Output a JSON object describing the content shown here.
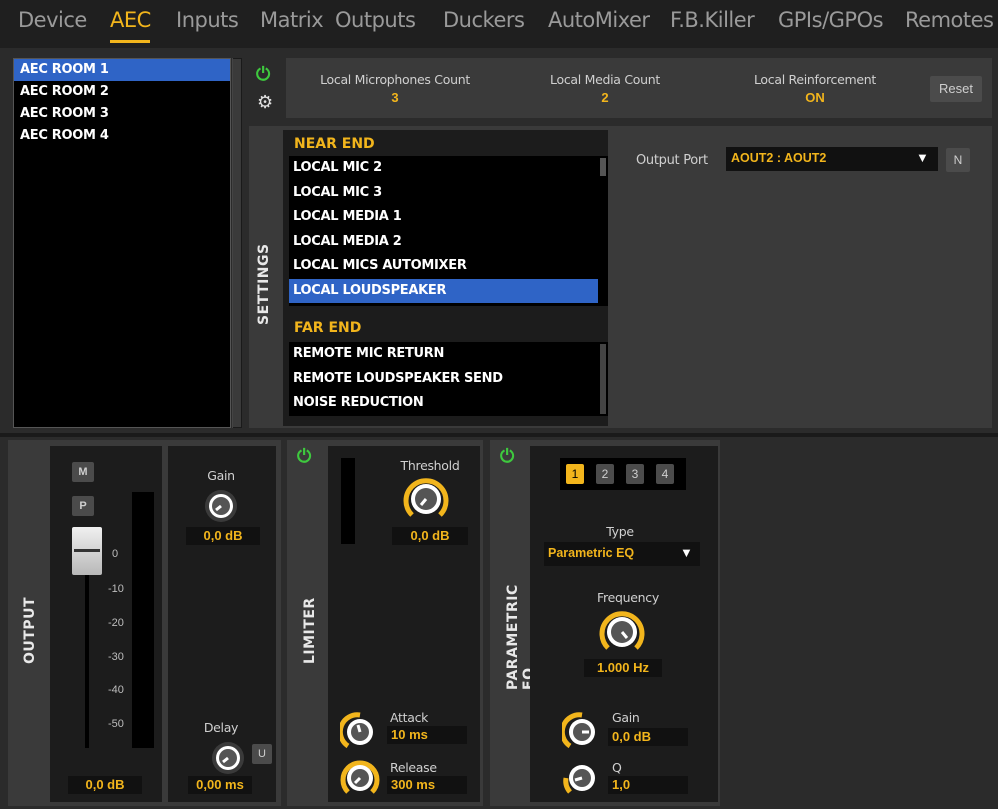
{
  "nav": {
    "tabs": [
      "Device",
      "AEC",
      "Inputs",
      "Matrix",
      "Outputs",
      "Duckers",
      "AutoMixer",
      "F.B.Killer",
      "GPIs/GPOs",
      "Remotes"
    ],
    "active": "AEC"
  },
  "rooms": [
    "AEC ROOM 1",
    "AEC ROOM 2",
    "AEC ROOM 3",
    "AEC ROOM 4"
  ],
  "top_info": {
    "mic_count_label": "Local Microphones Count",
    "mic_count_value": "3",
    "media_count_label": "Local Media Count",
    "media_count_value": "2",
    "reinforcement_label": "Local Reinforcement",
    "reinforcement_value": "ON",
    "reset_label": "Reset"
  },
  "settings": {
    "vertical_label": "SETTINGS",
    "near_end_title": "NEAR END",
    "near_end_items": [
      "LOCAL MIC 2",
      "LOCAL MIC 3",
      "LOCAL MEDIA 1",
      "LOCAL MEDIA 2",
      "LOCAL MICS AUTOMIXER",
      "LOCAL LOUDSPEAKER"
    ],
    "far_end_title": "FAR END",
    "far_end_items": [
      "REMOTE MIC RETURN",
      "REMOTE LOUDSPEAKER SEND",
      "NOISE REDUCTION"
    ],
    "output_port_label": "Output Port",
    "output_port_value": "AOUT2 : AOUT2",
    "n_button": "N"
  },
  "output": {
    "vertical_label": "OUTPUT",
    "m_button": "M",
    "p_button": "P",
    "scale": [
      "0",
      "-10",
      "-20",
      "-30",
      "-40",
      "-50"
    ],
    "fader_value": "0,0 dB",
    "gain_label": "Gain",
    "gain_value": "0,0 dB",
    "delay_label": "Delay",
    "delay_value": "0,00 ms",
    "u_button": "U"
  },
  "limiter": {
    "vertical_label": "LIMITER",
    "threshold_label": "Threshold",
    "threshold_value": "0,0 dB",
    "attack_label": "Attack",
    "attack_value": "10 ms",
    "release_label": "Release",
    "release_value": "300 ms"
  },
  "peq": {
    "vertical_label": "PARAMETRIC EQ",
    "bands": [
      "1",
      "2",
      "3",
      "4"
    ],
    "type_label": "Type",
    "type_value": "Parametric EQ",
    "frequency_label": "Frequency",
    "frequency_value": "1.000 Hz",
    "gain_label": "Gain",
    "gain_value": "0,0 dB",
    "q_label": "Q",
    "q_value": "1,0"
  },
  "colors": {
    "accent": "#f2b51c",
    "selection": "#2f64c6",
    "power": "#3ec93e"
  }
}
